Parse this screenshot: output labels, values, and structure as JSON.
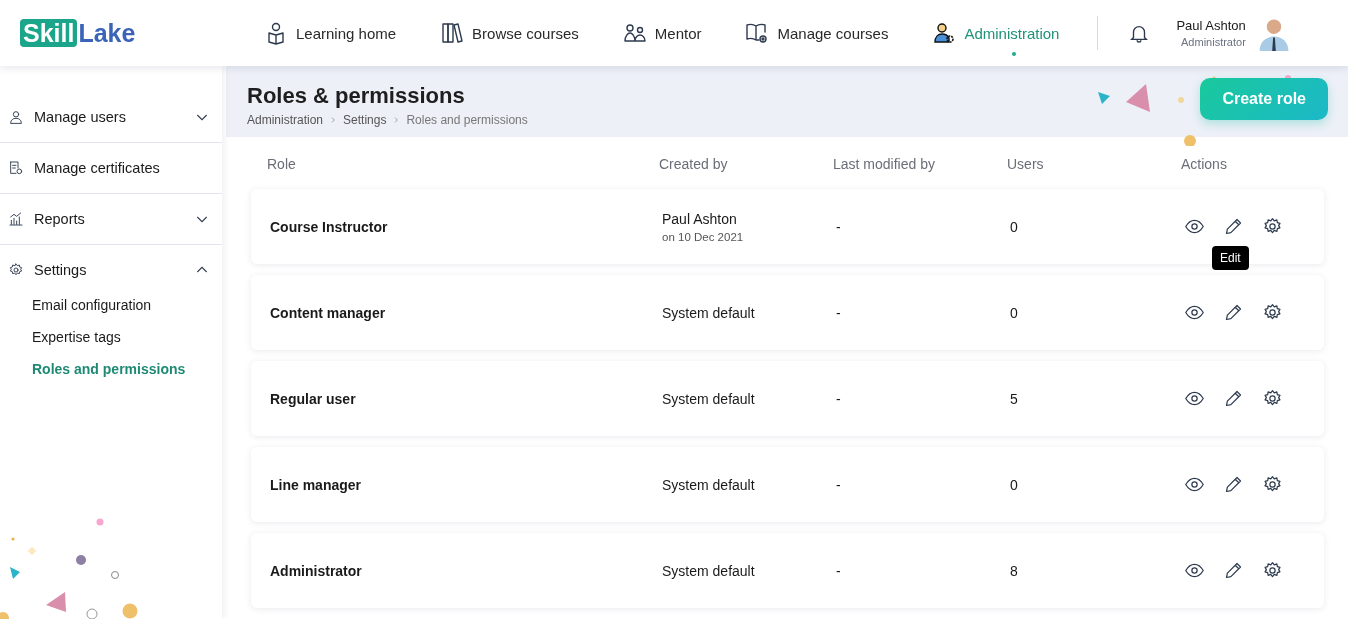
{
  "logo": {
    "part_1": "Skill",
    "part_2": "Lake"
  },
  "nav": [
    {
      "label": "Learning home",
      "selected": false
    },
    {
      "label": "Browse courses",
      "selected": false
    },
    {
      "label": "Mentor",
      "selected": false
    },
    {
      "label": "Manage courses",
      "selected": false
    },
    {
      "label": "Administration",
      "selected": true
    }
  ],
  "user": {
    "name": "Paul Ashton",
    "role": "Administrator"
  },
  "sidebar": {
    "items": [
      {
        "label": "Manage users",
        "expanded": false
      },
      {
        "label": "Manage certificates"
      },
      {
        "label": "Reports",
        "expanded": false
      },
      {
        "label": "Settings",
        "expanded": true,
        "children": [
          {
            "label": "Email configuration",
            "selected": false
          },
          {
            "label": "Expertise tags",
            "selected": false
          },
          {
            "label": "Roles and permissions",
            "selected": true
          }
        ]
      }
    ]
  },
  "page": {
    "title": "Roles & permissions",
    "breadcrumb": [
      "Administration",
      "Settings",
      "Roles and permissions"
    ],
    "button": "Create role"
  },
  "table": {
    "columns": [
      "Role",
      "Created by",
      "Last modified by",
      "Users",
      "Actions"
    ],
    "rows": [
      {
        "role": "Course Instructor",
        "created_by": "Paul Ashton",
        "created_on": "on 10 Dec 2021",
        "last_modified_by": "-",
        "users": "0",
        "tooltip": "Edit"
      },
      {
        "role": "Content manager",
        "created_by": "System default",
        "last_modified_by": "-",
        "users": "0"
      },
      {
        "role": "Regular user",
        "created_by": "System default",
        "last_modified_by": "-",
        "users": "5"
      },
      {
        "role": "Line manager",
        "created_by": "System default",
        "last_modified_by": "-",
        "users": "0"
      },
      {
        "role": "Administrator",
        "created_by": "System default",
        "last_modified_by": "-",
        "users": "8"
      }
    ]
  }
}
